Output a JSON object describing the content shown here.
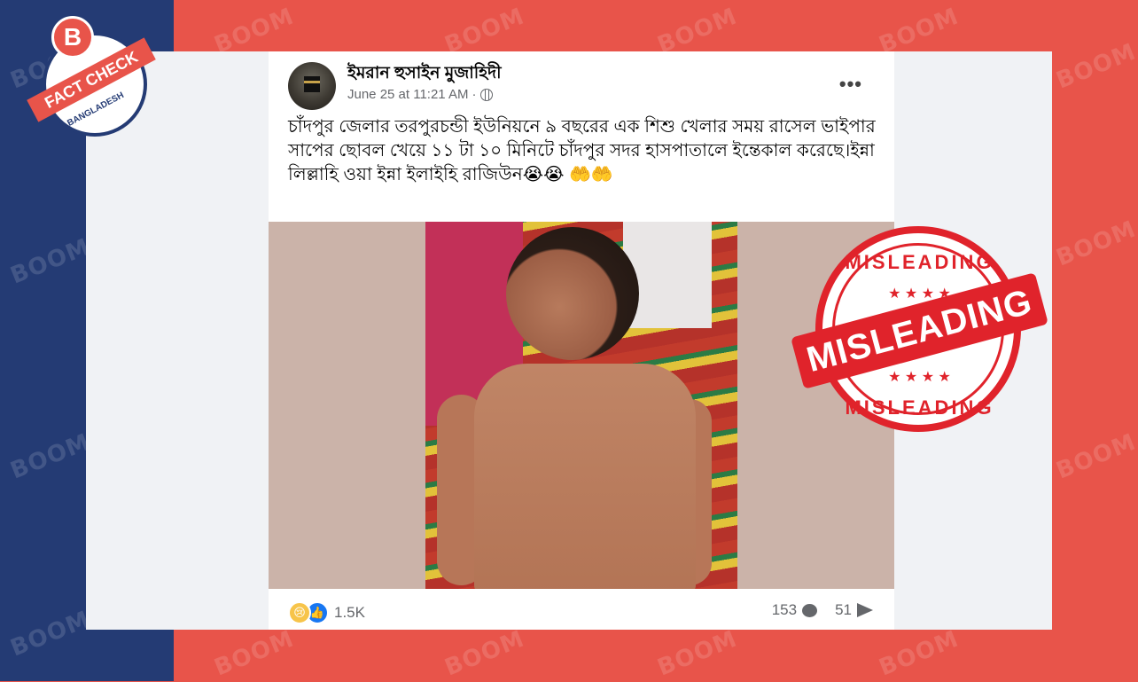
{
  "post": {
    "author": "ইমরান হুসাইন মুজাহিদী",
    "timestamp": "June 25 at 11:21 AM",
    "separator": "·",
    "more_label": "•••",
    "text": "চাঁদপুর জেলার তরপুরচন্ডী ইউনিয়নে ৯ বছরের এক শিশু খেলার সময় রাসেল ভাইপার সাপের ছোবল খেয়ে ১১ টা ১০ মিনিটে চাঁদপুর সদর হাসপাতালে ইন্তেকাল করেছে।ইন্না লিল্লাহি ওয়া ইন্না ইলাইহি রাজিউন😭😭 🤲🤲",
    "reactions_count": "1.5K",
    "comments_count": "153",
    "shares_count": "51"
  },
  "logo": {
    "letter": "B",
    "ribbon": "FACT CHECK",
    "country": "BANGLADESH"
  },
  "stamp": {
    "top": "MISLEADING",
    "main": "MISLEADING",
    "bottom": "MISLEADING"
  },
  "watermark": "BOOM",
  "colors": {
    "left_band": "#243b74",
    "background": "#e8544a",
    "stamp": "#e0232b"
  }
}
